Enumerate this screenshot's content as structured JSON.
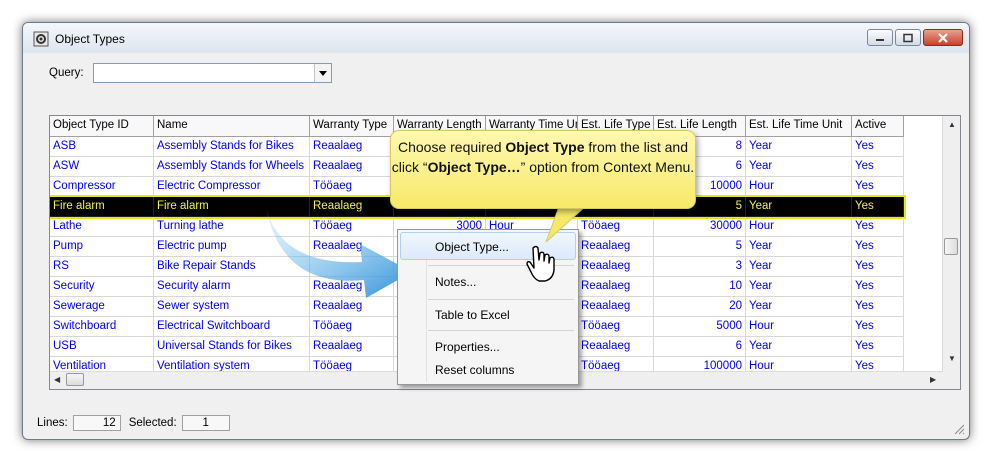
{
  "window": {
    "title": "Object Types"
  },
  "query": {
    "label": "Query:",
    "value": ""
  },
  "grid": {
    "columns": [
      "Object Type ID",
      "Name",
      "Warranty Type",
      "Warranty Length",
      "Warranty Time Unit",
      "Est. Life Type",
      "Est. Life Length",
      "Est. Life Time Unit",
      "Active"
    ],
    "rows": [
      {
        "id": "ASB",
        "name": "Assembly Stands for Bikes",
        "wtype": "Reaalaeg",
        "wlen": "",
        "wunit": "",
        "ltype": "",
        "llen": "8",
        "lunit": "Year",
        "active": "Yes"
      },
      {
        "id": "ASW",
        "name": "Assembly Stands for Wheels",
        "wtype": "Reaalaeg",
        "wlen": "",
        "wunit": "",
        "ltype": "",
        "llen": "6",
        "lunit": "Year",
        "active": "Yes"
      },
      {
        "id": "Compressor",
        "name": "Electric Compressor",
        "wtype": "Tööaeg",
        "wlen": "",
        "wunit": "",
        "ltype": "",
        "llen": "10000",
        "lunit": "Hour",
        "active": "Yes"
      },
      {
        "id": "Fire alarm",
        "name": "Fire alarm",
        "wtype": "Reaalaeg",
        "wlen": "",
        "wunit": "",
        "ltype": "",
        "llen": "5",
        "lunit": "Year",
        "active": "Yes"
      },
      {
        "id": "Lathe",
        "name": "Turning lathe",
        "wtype": "Tööaeg",
        "wlen": "3000",
        "wunit": "Hour",
        "ltype": "Tööaeg",
        "llen": "30000",
        "lunit": "Hour",
        "active": "Yes"
      },
      {
        "id": "Pump",
        "name": "Electric pump",
        "wtype": "Reaalaeg",
        "wlen": "",
        "wunit": "",
        "ltype": "Reaalaeg",
        "llen": "5",
        "lunit": "Year",
        "active": "Yes"
      },
      {
        "id": "RS",
        "name": "Bike Repair Stands",
        "wtype": "",
        "wlen": "",
        "wunit": "",
        "ltype": "Reaalaeg",
        "llen": "3",
        "lunit": "Year",
        "active": "Yes"
      },
      {
        "id": "Security",
        "name": "Security alarm",
        "wtype": "Reaalaeg",
        "wlen": "",
        "wunit": "",
        "ltype": "Reaalaeg",
        "llen": "10",
        "lunit": "Year",
        "active": "Yes"
      },
      {
        "id": "Sewerage",
        "name": "Sewer system",
        "wtype": "Reaalaeg",
        "wlen": "",
        "wunit": "",
        "ltype": "Reaalaeg",
        "llen": "20",
        "lunit": "Year",
        "active": "Yes"
      },
      {
        "id": "Switchboard",
        "name": "Electrical Switchboard",
        "wtype": "Tööaeg",
        "wlen": "",
        "wunit": "",
        "ltype": "Tööaeg",
        "llen": "5000",
        "lunit": "Hour",
        "active": "Yes"
      },
      {
        "id": "USB",
        "name": "Universal Stands for Bikes",
        "wtype": "Reaalaeg",
        "wlen": "",
        "wunit": "",
        "ltype": "Reaalaeg",
        "llen": "6",
        "lunit": "Year",
        "active": "Yes"
      },
      {
        "id": "Ventilation",
        "name": "Ventilation system",
        "wtype": "Tööaeg",
        "wlen": "",
        "wunit": "",
        "ltype": "Tööaeg",
        "llen": "100000",
        "lunit": "Hour",
        "active": "Yes"
      }
    ]
  },
  "context_menu": {
    "items": [
      "Object Type...",
      "Notes...",
      "Table to Excel",
      "Properties...",
      "Reset columns"
    ]
  },
  "callout": {
    "part1": "Choose required ",
    "bold1": "Object Type",
    "part2": " from the list and click “",
    "bold2": "Object Type…",
    "part3": "” option from Context Menu."
  },
  "status": {
    "lines_label": "Lines:",
    "lines_value": "12",
    "selected_label": "Selected:",
    "selected_value": "1"
  },
  "colors": {
    "link_text": "#0000ee",
    "selected_row_bg": "#000000",
    "selected_row_text": "#f3f14a",
    "callout_bg": "#f8ee7a",
    "arrow": "#3aa0e0"
  },
  "icons": [
    "app-icon",
    "minimize-icon",
    "maximize-icon",
    "close-icon",
    "dropdown-arrow-icon",
    "hand-cursor-icon",
    "resize-grip-icon",
    "curved-arrow-icon"
  ]
}
